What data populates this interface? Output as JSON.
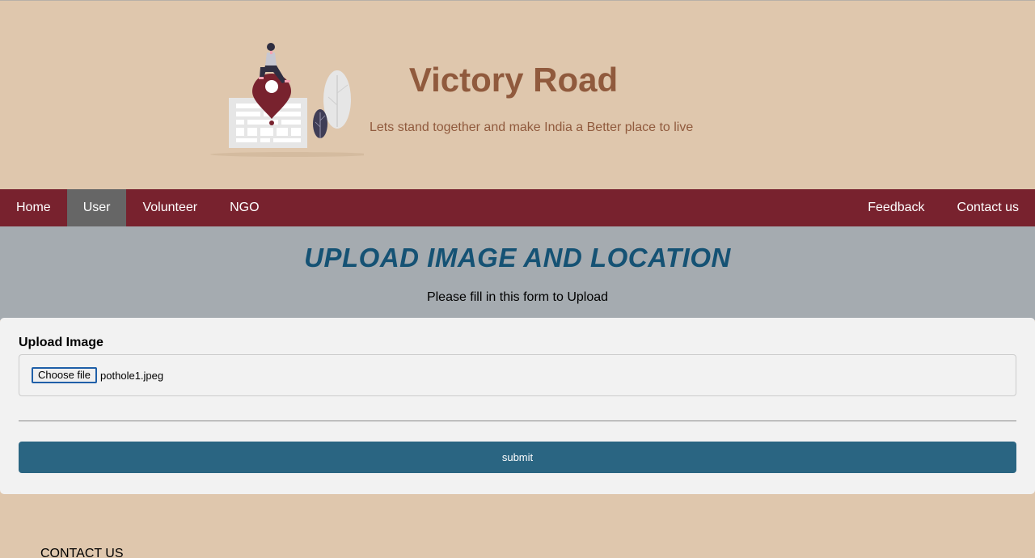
{
  "header": {
    "title": "Victory Road",
    "tagline": "Lets stand together and make India a Better place to live",
    "illustration_icon": "map-pin-illustration-icon"
  },
  "nav": {
    "left": [
      {
        "label": "Home",
        "active": false
      },
      {
        "label": "User",
        "active": true
      },
      {
        "label": "Volunteer",
        "active": false
      },
      {
        "label": "NGO",
        "active": false
      }
    ],
    "right": [
      {
        "label": "Feedback",
        "active": false
      },
      {
        "label": "Contact us",
        "active": false
      }
    ]
  },
  "main": {
    "title": "UPLOAD IMAGE AND LOCATION",
    "instructions": "Please fill in this form to Upload"
  },
  "form": {
    "upload_label": "Upload Image",
    "choose_button": "Choose file",
    "file_name": "pothole1.jpeg",
    "submit_label": "submit"
  },
  "footer": {
    "heading": "CONTACT US"
  },
  "colors": {
    "background": "#dfc7ad",
    "nav": "#78222e",
    "nav_active": "#666666",
    "title": "#905a3d",
    "section_title": "#155274",
    "submit": "#2a6582"
  }
}
